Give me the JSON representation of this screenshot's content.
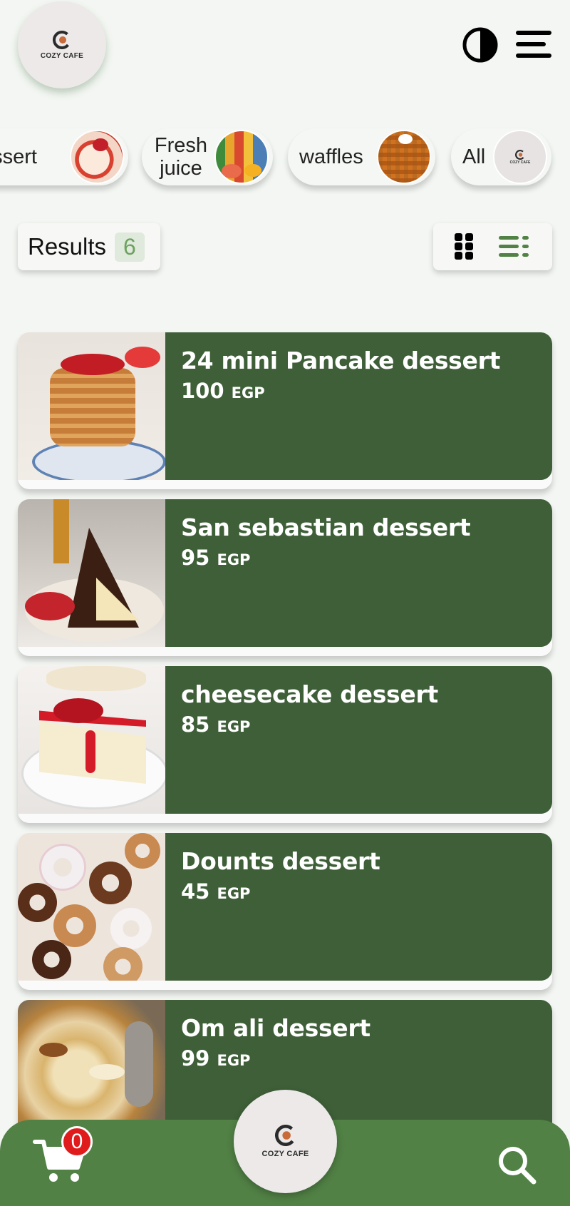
{
  "brand": {
    "name": "COZY CAFE",
    "colors": {
      "primary": "#3e5f38",
      "bar": "#518145",
      "accent": "#6ca25f",
      "badge": "#e01b1b"
    }
  },
  "header": {
    "theme_icon": "contrast-icon",
    "menu_icon": "hamburger-menu-icon"
  },
  "categories": [
    {
      "label": "Dessert",
      "icon": "dessert-image"
    },
    {
      "label": "Fresh juice",
      "icon": "juice-image"
    },
    {
      "label": "waffles",
      "icon": "waffles-image"
    },
    {
      "label": "All",
      "icon": "cozy-cafe-logo"
    }
  ],
  "results": {
    "label": "Results",
    "count": "6"
  },
  "view_toggle": {
    "grid_icon": "grid-view-icon",
    "list_icon": "list-view-icon",
    "active": "list"
  },
  "items": [
    {
      "name": "24 mini Pancake dessert",
      "price": "100",
      "currency": "EGP"
    },
    {
      "name": "San sebastian dessert",
      "price": "95",
      "currency": "EGP"
    },
    {
      "name": "cheesecake dessert",
      "price": "85",
      "currency": "EGP"
    },
    {
      "name": "Dounts dessert",
      "price": "45",
      "currency": "EGP"
    },
    {
      "name": "Om ali dessert",
      "price": "99",
      "currency": "EGP"
    }
  ],
  "bottom_bar": {
    "cart_count": "0",
    "cart_icon": "cart-icon",
    "search_icon": "search-icon"
  }
}
